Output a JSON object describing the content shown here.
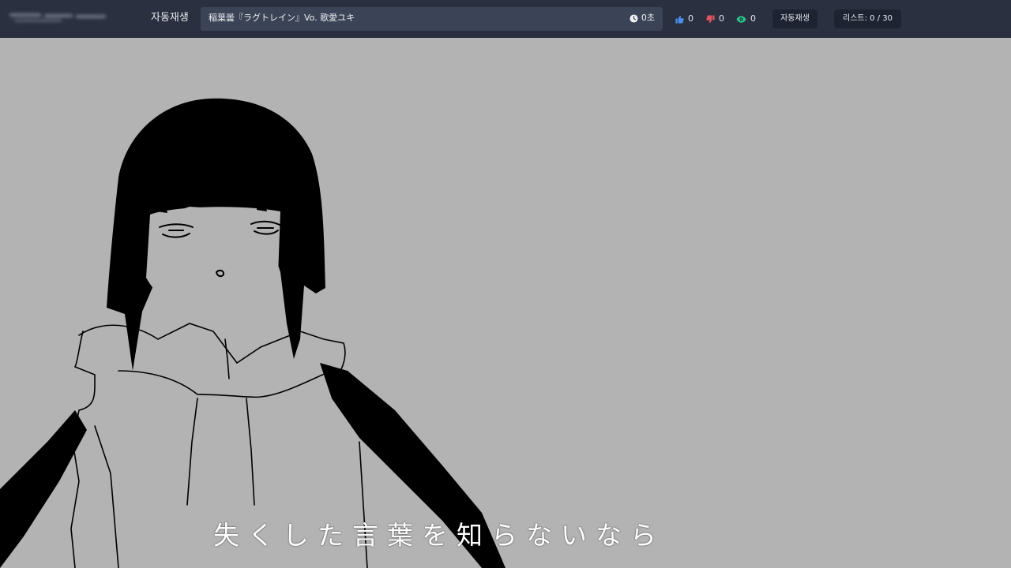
{
  "header": {
    "autoplay_label": "자동재생",
    "video_title": "稲葉曇『ラグトレイン』Vo. 歌愛ユキ",
    "duration": "0초",
    "likes": "0",
    "dislikes": "0",
    "views": "0",
    "autoplay_button": "자동재생",
    "list_counter": "리스트: 0 / 30"
  },
  "player": {
    "subtitle": "失くした言葉を知らないなら"
  },
  "icons": {
    "clock": "clock-icon",
    "like": "thumbs-up-icon",
    "dislike": "thumbs-down-icon",
    "views": "eye-icon"
  },
  "colors": {
    "topbar": "#2b3040",
    "title_box": "#3b4356",
    "button_bg": "#1e2331",
    "like": "#4a8ff0",
    "dislike": "#e0555f",
    "views": "#27c98a",
    "video_bg": "#b3b3b3"
  }
}
